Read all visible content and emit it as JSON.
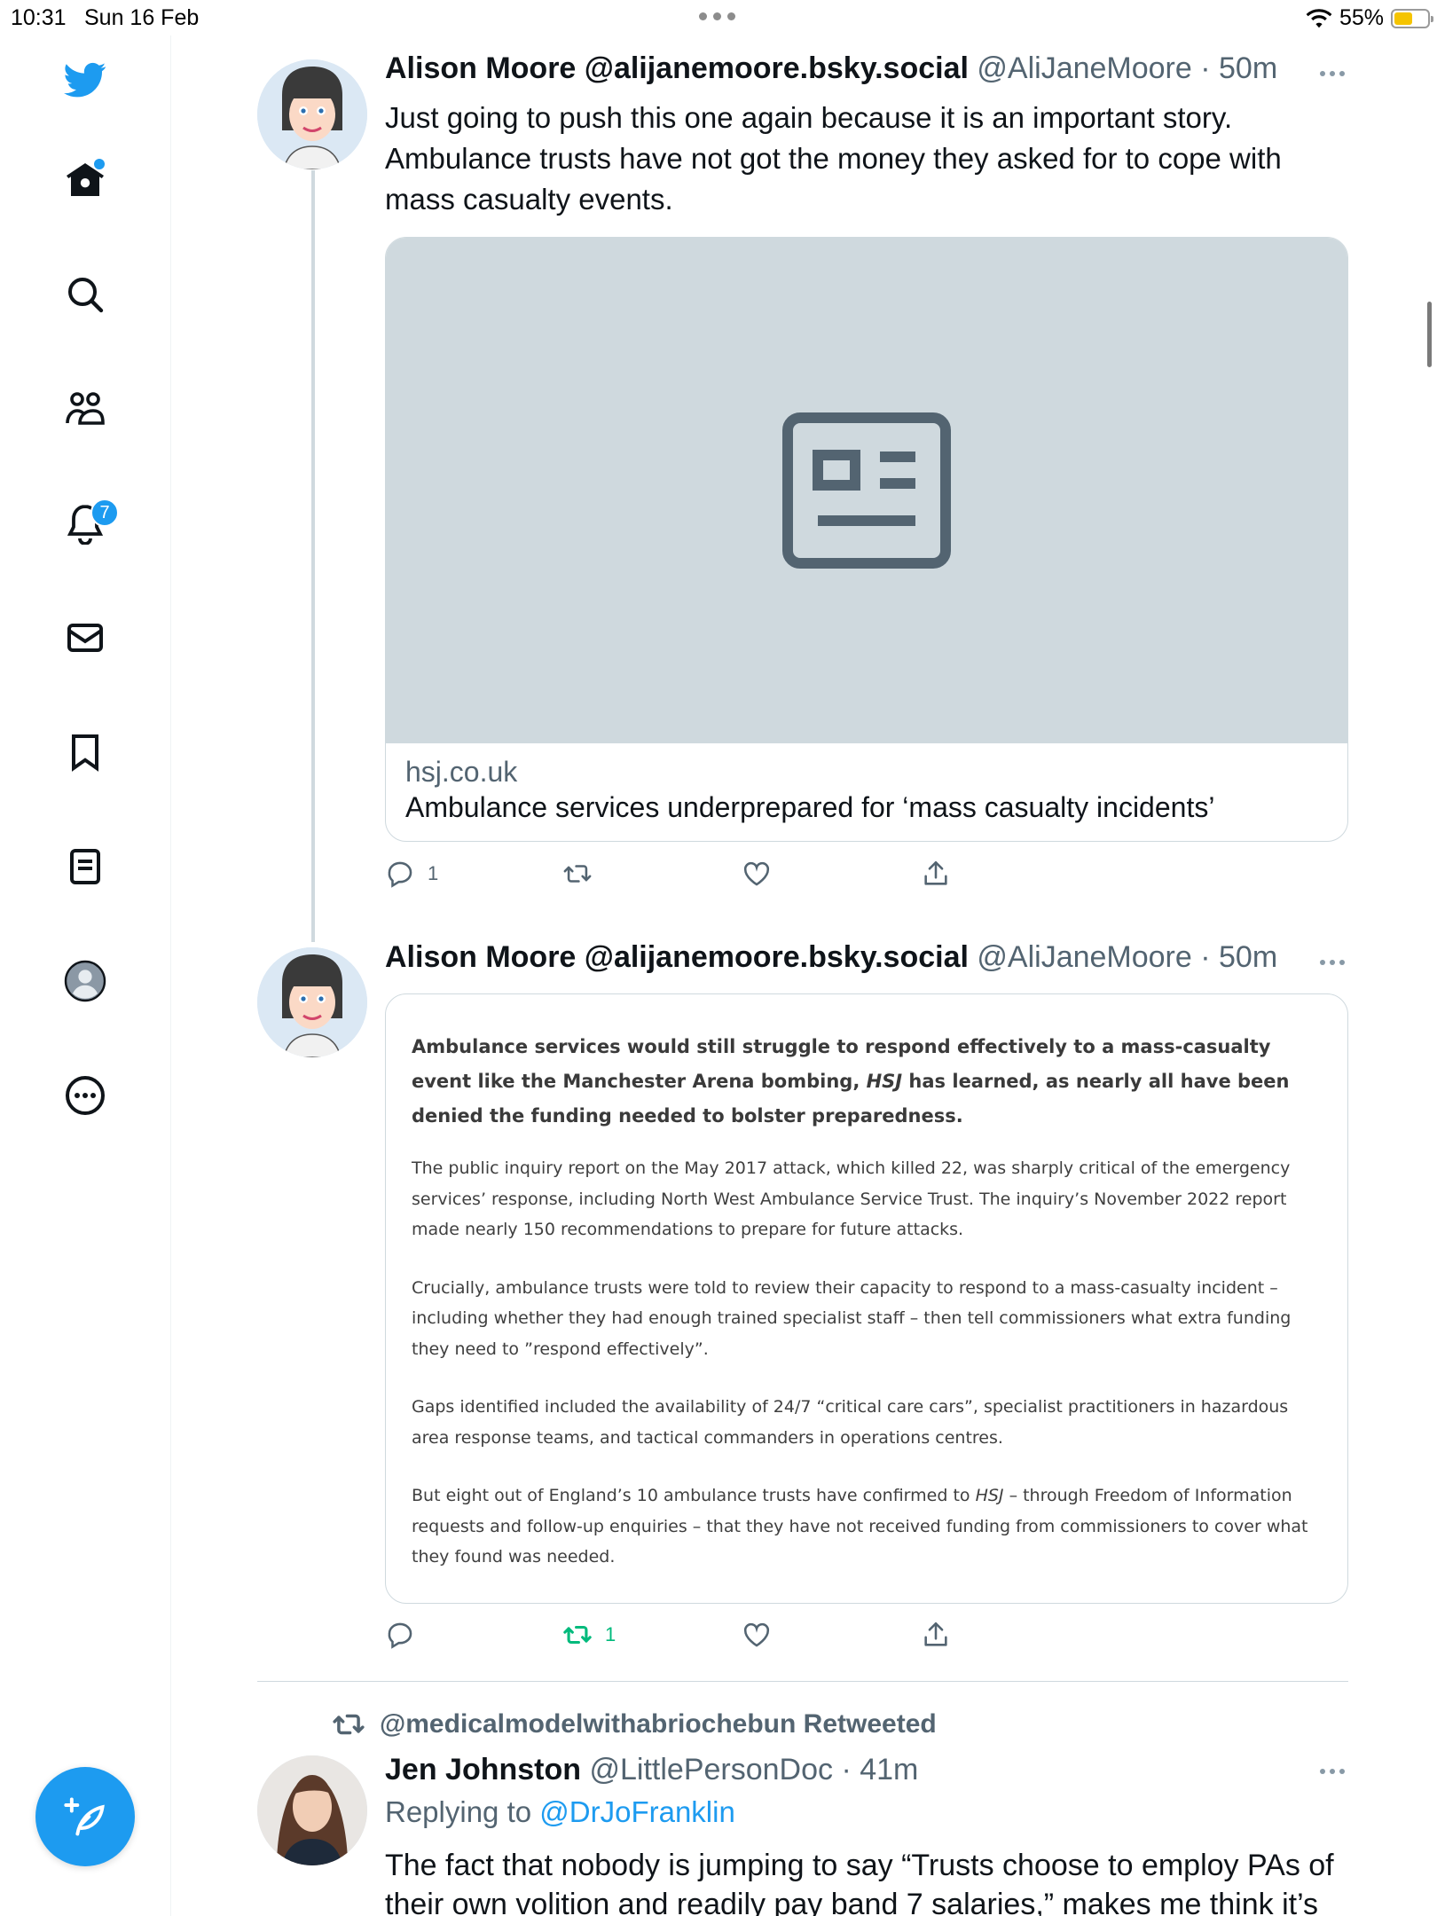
{
  "status_bar": {
    "time": "10:31",
    "date": "Sun 16 Feb",
    "battery": "55%",
    "battery_level": 0.55
  },
  "sidebar": {
    "items": [
      {
        "icon": "twitter-bird-icon"
      },
      {
        "icon": "home-icon"
      },
      {
        "icon": "search-icon"
      },
      {
        "icon": "communities-icon"
      },
      {
        "icon": "bell-icon",
        "badge": "7"
      },
      {
        "icon": "mail-icon"
      },
      {
        "icon": "bookmark-icon"
      },
      {
        "icon": "lists-icon"
      },
      {
        "icon": "profile-icon"
      },
      {
        "icon": "more-icon"
      }
    ],
    "compose_icon": "compose-feather-icon"
  },
  "colors": {
    "accent": "#1d9bf0",
    "retweet_green": "#00ba7c",
    "muted": "#536471"
  },
  "tweets": [
    {
      "name": "Alison Moore @alijanemoore.bsky.social",
      "handle": "@AliJaneMoore",
      "time": "· 50m",
      "text": "Just going to push this one again because it is an important story. Ambulance trusts have not got the money they asked for to cope with mass casualty events.",
      "link_card": {
        "domain": "hsj.co.uk",
        "title": "Ambulance services underprepared for ‘mass casualty incidents’"
      },
      "actions": {
        "reply_count": "1",
        "retweet_count": "",
        "like_count": ""
      }
    },
    {
      "name": "Alison Moore @alijanemoore.bsky.social",
      "handle": "@AliJaneMoore",
      "time": "· 50m",
      "article_image": {
        "lead_1": "Ambulance services would still struggle to respond effectively to a mass-casualty event like the Manchester Arena bombing, ",
        "lead_em": "HSJ",
        "lead_2": " has learned, as nearly all have been denied the funding needed to bolster preparedness.",
        "p1": "The public inquiry report on the May 2017 attack, which killed 22, was sharply critical of the emergency services’ response, including North West Ambulance Service Trust. The inquiry’s November 2022 report made nearly 150 recommendations to prepare for future attacks.",
        "p2": "Crucially, ambulance trusts were told to review their capacity to respond to a mass-casualty incident – including whether they had enough trained specialist staff – then tell commissioners what extra funding they need to ”respond effectively”.",
        "p3": "Gaps identified included the availability of 24/7 “critical care cars”, specialist practitioners in hazardous area response teams, and tactical commanders in operations centres.",
        "p4_1": "But eight out of England’s 10 ambulance trusts have confirmed to ",
        "p4_em": "HSJ",
        "p4_2": " – through Freedom of Information requests and follow-up enquiries – that they have not received funding from commissioners to cover what they found was needed."
      },
      "actions": {
        "reply_count": "",
        "retweet_count": "1",
        "like_count": ""
      }
    },
    {
      "retweeted_by": "@medicalmodelwithabriochebun Retweeted",
      "name": "Jen Johnston",
      "handle": "@LittlePersonDoc",
      "time": "· 41m",
      "replying_prefix": "Replying to ",
      "replying_to": "@DrJoFranklin",
      "text": "The fact that nobody is jumping to say “Trusts choose to employ PAs of their own volition and readily pay band 7 salaries,” makes me think it’s"
    }
  ]
}
